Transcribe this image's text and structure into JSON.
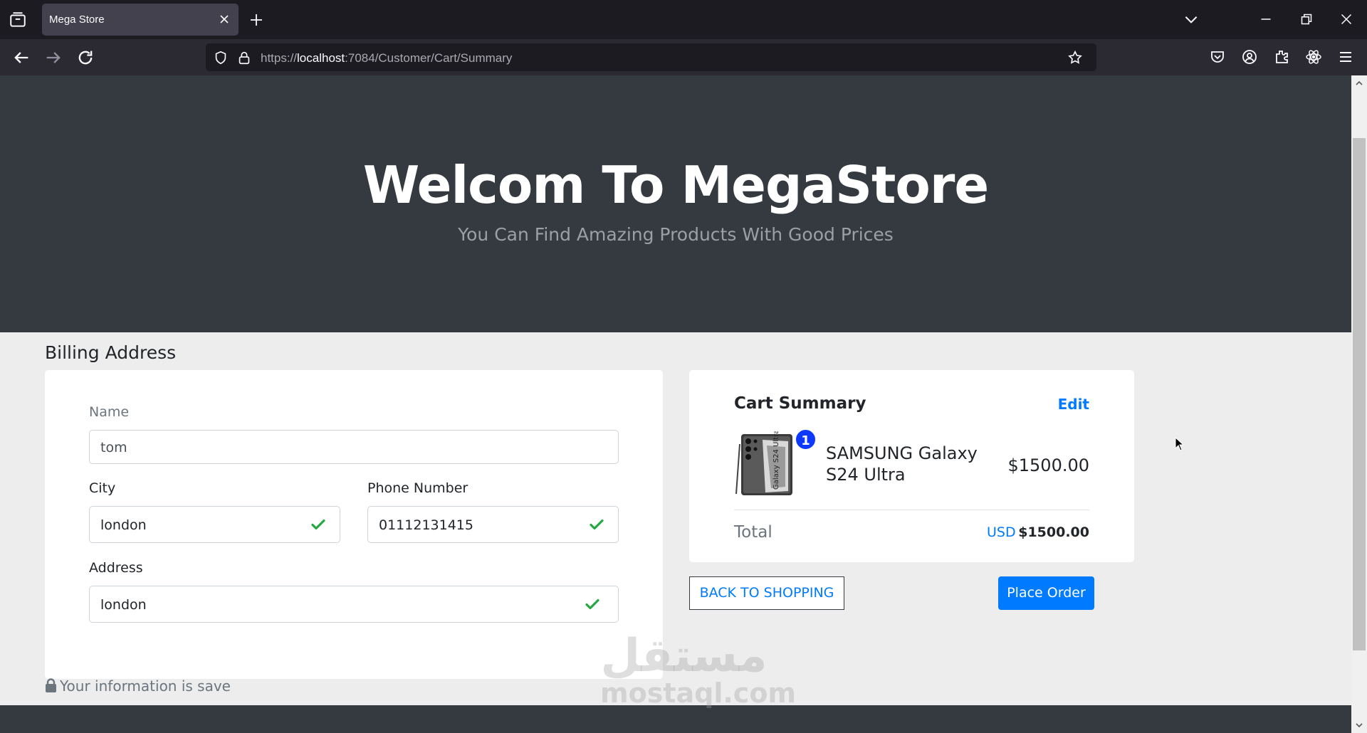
{
  "browser": {
    "tab_title": "Mega Store",
    "url_scheme": "https://",
    "url_host": "localhost",
    "url_path": ":7084/Customer/Cart/Summary"
  },
  "hero": {
    "title": "Welcom To MegaStore",
    "subtitle": "You Can Find Amazing Products With Good Prices"
  },
  "billing": {
    "heading": "Billing Address",
    "name_label": "Name",
    "name_value": "tom",
    "city_label": "City",
    "city_value": "london",
    "phone_label": "Phone Number",
    "phone_value": "01112131415",
    "address_label": "Address",
    "address_value": "london",
    "secure_note": "Your information is save"
  },
  "summary": {
    "title": "Cart Summary",
    "edit_label": "Edit",
    "item": {
      "name": "SAMSUNG Galaxy S24 Ultra",
      "price": "$1500.00",
      "quantity": "1",
      "image_text": "Galaxy S24 Ultra"
    },
    "total_label": "Total",
    "total_currency": "USD",
    "total_amount": "$1500.00"
  },
  "actions": {
    "back_label": "BACK TO SHOPPING",
    "place_label": "Place Order"
  },
  "watermark": {
    "arabic": "مستقل",
    "latin": "mostaql.com"
  },
  "colors": {
    "primary": "#007bff",
    "hero_bg": "#343a40",
    "valid_green": "#28a745",
    "badge": "#0d39ff"
  }
}
